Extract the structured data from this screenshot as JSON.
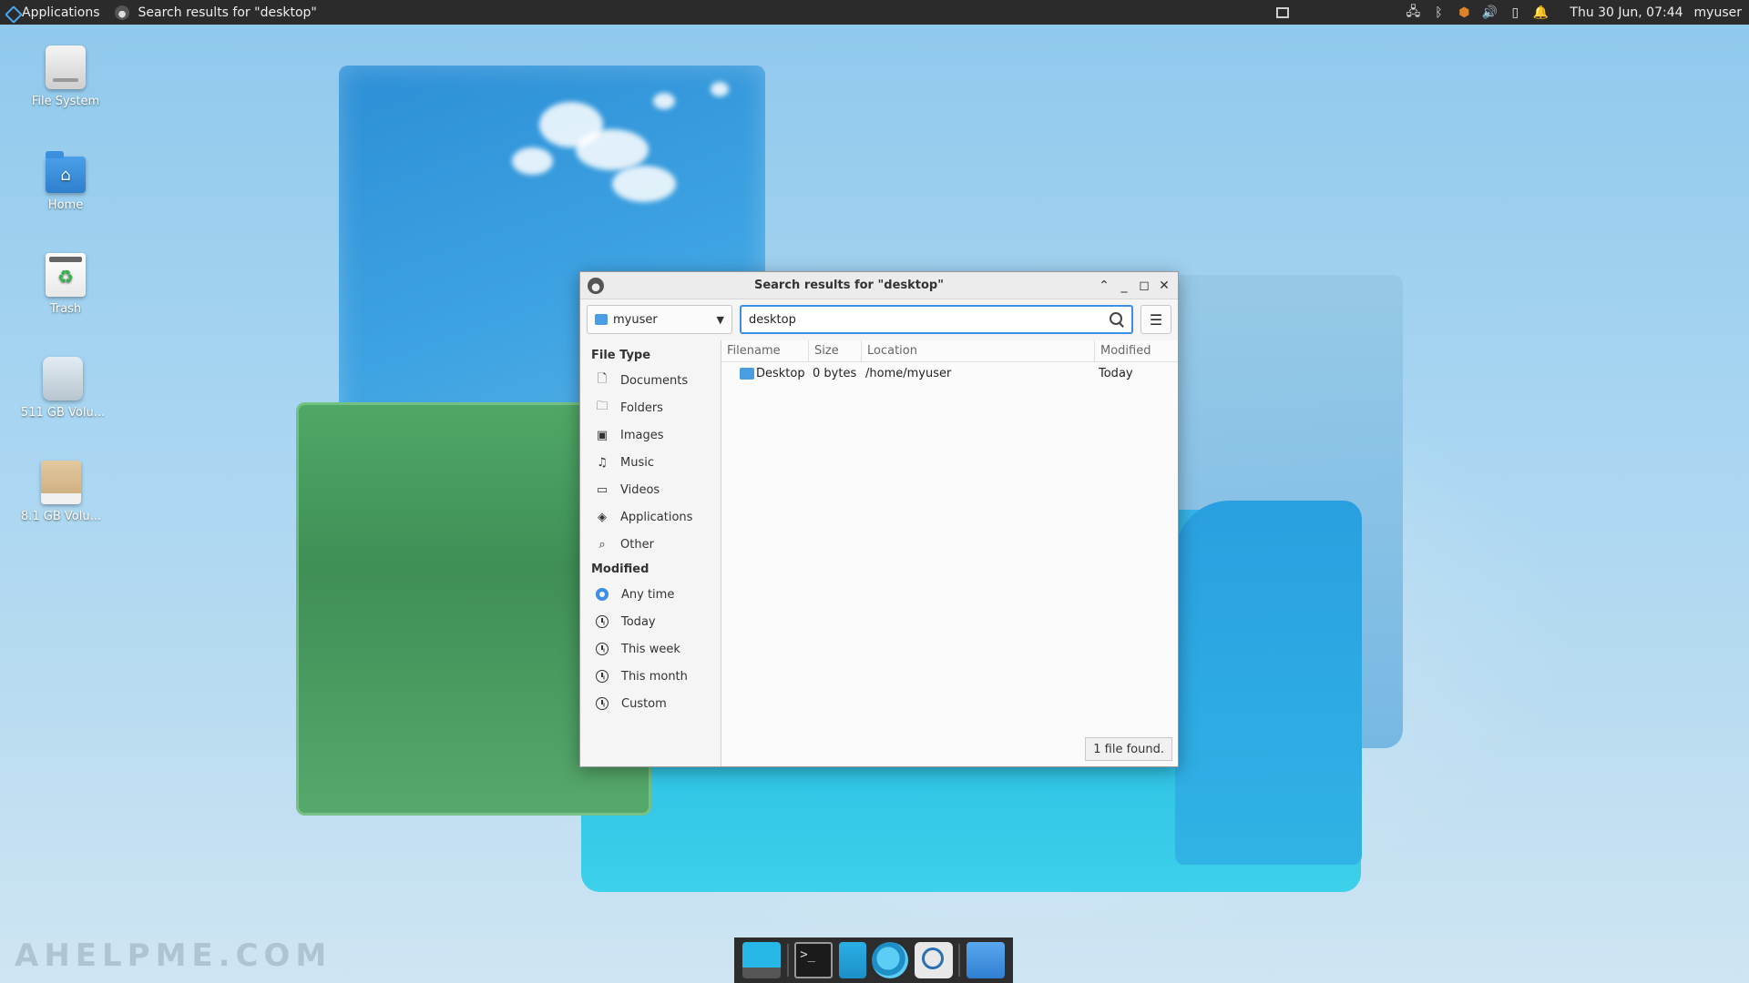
{
  "top_panel": {
    "applications_label": "Applications",
    "task_title": "Search results for \"desktop\"",
    "clock": "Thu 30 Jun, 07:44",
    "username": "myuser",
    "tray_icons": [
      "network-icon",
      "bluetooth-icon",
      "shield-icon",
      "volume-icon",
      "battery-icon",
      "bell-icon"
    ]
  },
  "desktop_icons": [
    {
      "label": "File System",
      "icon": "drive-icon"
    },
    {
      "label": "Home",
      "icon": "home-folder-icon"
    },
    {
      "label": "Trash",
      "icon": "trash-icon"
    },
    {
      "label": "511 GB Volu...",
      "icon": "volume-icon"
    },
    {
      "label": "8.1 GB Volu...",
      "icon": "volume-icon"
    }
  ],
  "watermark": "AHELPME.COM",
  "window": {
    "title": "Search results for \"desktop\"",
    "path_button": "myuser",
    "search": {
      "value": "desktop",
      "placeholder": ""
    },
    "sidebar": {
      "file_type_header": "File Type",
      "file_types": [
        {
          "label": "Documents",
          "icon": "document-icon"
        },
        {
          "label": "Folders",
          "icon": "folder-icon"
        },
        {
          "label": "Images",
          "icon": "image-icon"
        },
        {
          "label": "Music",
          "icon": "music-icon"
        },
        {
          "label": "Videos",
          "icon": "video-icon"
        },
        {
          "label": "Applications",
          "icon": "applications-icon"
        },
        {
          "label": "Other",
          "icon": "search-icon"
        }
      ],
      "modified_header": "Modified",
      "modified": [
        {
          "label": "Any time",
          "selected": true
        },
        {
          "label": "Today",
          "selected": false
        },
        {
          "label": "This week",
          "selected": false
        },
        {
          "label": "This month",
          "selected": false
        },
        {
          "label": "Custom",
          "selected": false
        }
      ]
    },
    "columns": {
      "filename": "Filename",
      "size": "Size",
      "location": "Location",
      "modified": "Modified"
    },
    "rows": [
      {
        "filename": "Desktop",
        "size": "0 bytes",
        "location": "/home/myuser",
        "modified": "Today"
      }
    ],
    "status": "1 file found."
  }
}
